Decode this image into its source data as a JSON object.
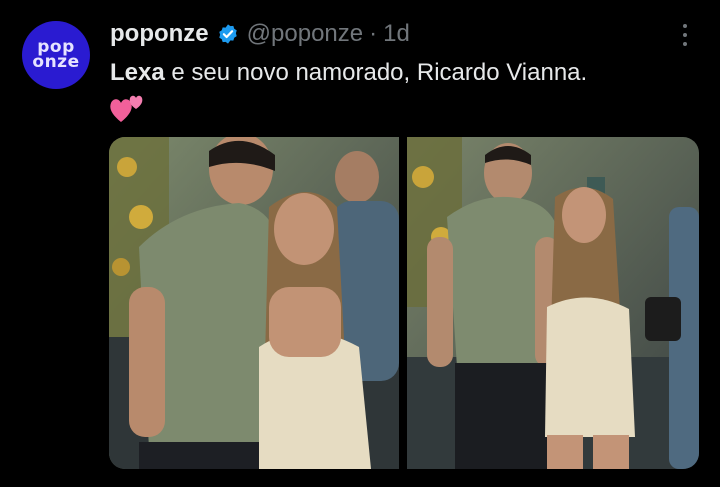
{
  "author": {
    "avatar_line1": "pop",
    "avatar_line2": "onze",
    "display_name": "poponze",
    "handle": "@poponze",
    "separator": "·",
    "time": "1d",
    "verified_icon": "verified-badge-icon",
    "avatar_color": "#2a1bd1"
  },
  "tweet": {
    "bold_text": "Lexa",
    "text": " e seu novo namorado, Ricardo Vianna.",
    "emoji": "two-hearts-emoji"
  },
  "menu": {
    "icon": "more-vertical-icon"
  },
  "media": {
    "photos": [
      {
        "name": "photo-couple-laughing"
      },
      {
        "name": "photo-couple-walking"
      }
    ]
  },
  "colors": {
    "background": "#000000",
    "text_primary": "#e7e9ea",
    "text_secondary": "#71767b",
    "verified": "#1d9bf0",
    "heart": "#f2609a"
  }
}
